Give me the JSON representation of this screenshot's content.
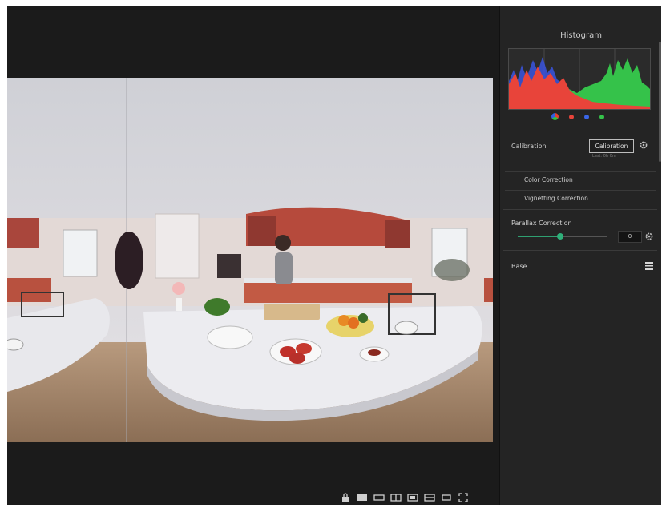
{
  "panel": {
    "histogram_title": "Histogram",
    "histogram": {
      "channels": [
        {
          "name": "all-channels-icon"
        },
        {
          "name": "red-channel",
          "color": "#e8443a"
        },
        {
          "name": "blue-channel",
          "color": "#3a66e8"
        },
        {
          "name": "green-channel",
          "color": "#35c24a"
        }
      ]
    },
    "calibration": {
      "label": "Calibration",
      "button": "Calibration",
      "sub": "Last: 0h 0m"
    },
    "color_correction": "Color Correction",
    "vignetting_correction": "Vignetting Correction",
    "parallax": {
      "label": "Parallax Correction",
      "value": "0",
      "slider_level": 0.47
    },
    "base": {
      "label": "Base"
    }
  },
  "toolbar": {
    "icons": [
      "lock-icon",
      "layout-single-icon",
      "layout-wide-icon",
      "layout-split-icon",
      "layout-dual-icon",
      "layout-quad-icon",
      "layout-small-icon",
      "fullscreen-icon"
    ]
  },
  "colors": {
    "accent": "#2fb07a",
    "panel_bg": "#242424",
    "app_bg": "#1b1b1b"
  }
}
